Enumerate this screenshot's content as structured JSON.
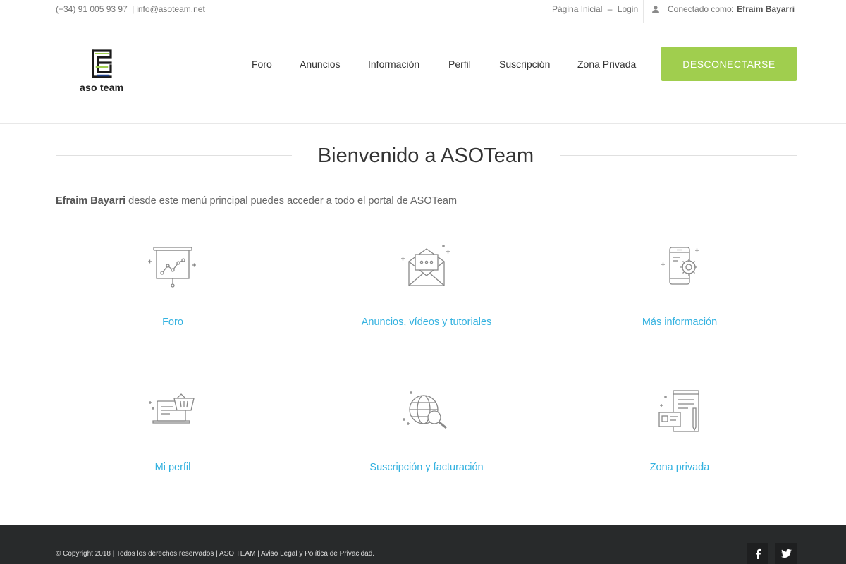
{
  "topbar": {
    "phone": "(+34) 91 005 93 97",
    "separator": "|",
    "email": "info@asoteam.net",
    "home_link": "Página Inicial",
    "dash": "–",
    "login_link": "Login",
    "connected_label": "Conectado como:",
    "user_name": "Efraim Bayarri"
  },
  "header": {
    "logo_text": "aso team",
    "nav": [
      "Foro",
      "Anuncios",
      "Información",
      "Perfil",
      "Suscripción",
      "Zona Privada"
    ],
    "logout_button": "DESCONECTARSE"
  },
  "main": {
    "title": "Bienvenido a ASOTeam",
    "intro_name": "Efraim Bayarri",
    "intro_text": " desde este menú principal puedes acceder a todo el portal de ASOTeam",
    "items": [
      {
        "label": "Foro",
        "icon": "presentation-chart-icon"
      },
      {
        "label": "Anuncios, vídeos y tutoriales",
        "icon": "envelope-icon"
      },
      {
        "label": "Más información",
        "icon": "mobile-gear-icon"
      },
      {
        "label": "Mi perfil",
        "icon": "laptop-basket-icon"
      },
      {
        "label": "Suscripción y facturación",
        "icon": "globe-search-icon"
      },
      {
        "label": "Zona privada",
        "icon": "documents-pen-icon"
      }
    ]
  },
  "footer": {
    "copyright": "© Copyright 2018 | Todos los derechos reservados | ASO TEAM | Aviso Legal y Política de Privacidad.",
    "social": [
      "facebook-icon",
      "twitter-icon"
    ]
  },
  "colors": {
    "accent_green": "#a0ce4e",
    "link_blue": "#34b2e0",
    "footer_bg": "#282a2b"
  }
}
